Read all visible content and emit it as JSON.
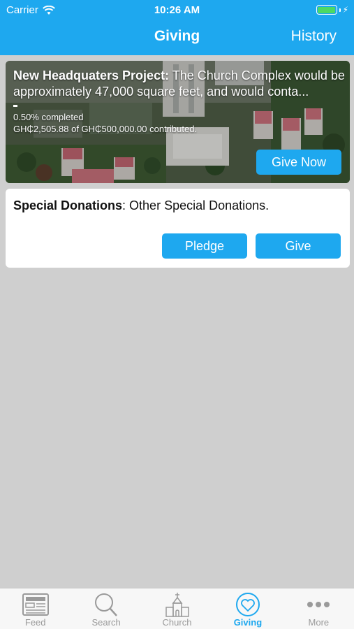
{
  "status_bar": {
    "carrier": "Carrier",
    "time": "10:26 AM",
    "wifi_icon": "wifi-icon",
    "battery_icon": "battery-icon",
    "bolt": "⚡"
  },
  "nav": {
    "title": "Giving",
    "history_label": "History"
  },
  "project": {
    "title": "New Headquaters Project:",
    "description": " The Church Complex would be approximately 47,000 square feet, and would conta...",
    "progress_fraction": 0.005,
    "completed_text": "0.50% completed",
    "contributed_text": "GH₵2,505.88 of GH₵500,000.00 contributed.",
    "give_now_label": "Give Now"
  },
  "special": {
    "title": "Special Donations",
    "description": ": Other Special Donations.",
    "pledge_label": "Pledge",
    "give_label": "Give"
  },
  "tabs": [
    {
      "label": "Feed",
      "icon": "feed-icon",
      "active": false
    },
    {
      "label": "Search",
      "icon": "search-icon",
      "active": false
    },
    {
      "label": "Church",
      "icon": "church-icon",
      "active": false
    },
    {
      "label": "Giving",
      "icon": "heart-icon",
      "active": true
    },
    {
      "label": "More",
      "icon": "more-icon",
      "active": false
    }
  ],
  "colors": {
    "accent": "#1ea8ef",
    "background": "#cfcfcf",
    "battery": "#4cd964"
  }
}
